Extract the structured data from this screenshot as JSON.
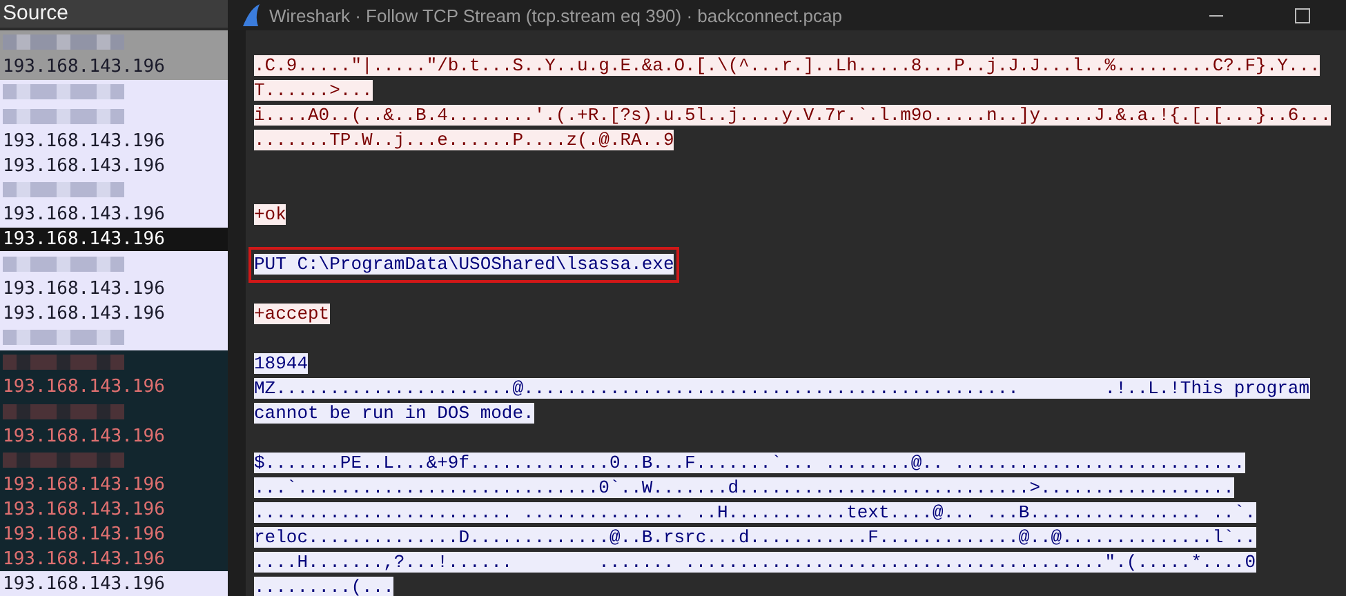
{
  "packet_list": {
    "column_header": "Source",
    "groups": [
      {
        "kind": "marked",
        "rows": [
          {
            "kind": "redacted",
            "selected": false
          },
          {
            "kind": "address",
            "text": "193.168.143.196",
            "selected": false
          }
        ]
      },
      {
        "kind": "plain",
        "rows": [
          {
            "kind": "redacted",
            "selected": false
          },
          {
            "kind": "redacted",
            "selected": false
          },
          {
            "kind": "address",
            "text": "193.168.143.196",
            "selected": false
          },
          {
            "kind": "address",
            "text": "193.168.143.196",
            "selected": false
          },
          {
            "kind": "redacted",
            "selected": false
          },
          {
            "kind": "address",
            "text": "193.168.143.196",
            "selected": false
          },
          {
            "kind": "address",
            "text": "193.168.143.196",
            "selected": true
          },
          {
            "kind": "redacted",
            "selected": false
          },
          {
            "kind": "address",
            "text": "193.168.143.196",
            "selected": false
          },
          {
            "kind": "address",
            "text": "193.168.143.196",
            "selected": false
          },
          {
            "kind": "redacted",
            "selected": false
          }
        ]
      },
      {
        "kind": "alert",
        "rows": [
          {
            "kind": "redacted",
            "selected": false
          },
          {
            "kind": "address",
            "text": "193.168.143.196",
            "selected": false
          },
          {
            "kind": "redacted",
            "selected": false
          },
          {
            "kind": "address",
            "text": "193.168.143.196",
            "selected": false
          },
          {
            "kind": "redacted",
            "selected": false
          },
          {
            "kind": "address",
            "text": "193.168.143.196",
            "selected": false
          },
          {
            "kind": "address",
            "text": "193.168.143.196",
            "selected": false
          },
          {
            "kind": "address",
            "text": "193.168.143.196",
            "selected": false
          },
          {
            "kind": "address",
            "text": "193.168.143.196",
            "selected": false
          }
        ]
      },
      {
        "kind": "plain",
        "rows": [
          {
            "kind": "address",
            "text": "193.168.143.196",
            "selected": false
          }
        ]
      }
    ]
  },
  "window": {
    "title": "Wireshark · Follow TCP Stream (tcp.stream eq 390) · backconnect.pcap"
  },
  "stream": [
    {
      "kind": "client",
      "highlighted": false,
      "lines": [
        ".C.9.....\"|.....\"/b.t...S..Y..u.g.E.&a.O.[.\\(^...r.]..Lh.....8...P..j.J.J...l..%.........C?.F}.Y...",
        "T......>...",
        "i....A0..(..&..B.4........'.(.+R.[?s).u.5l..j....y.V.7r.`.l.m9o.....n..]y.....J.&.a.!{.[.[...}..6...",
        ".......TP.W..j...e......P....z(.@.RA..9"
      ]
    },
    {
      "kind": "client",
      "highlighted": false,
      "lines": [
        "+ok"
      ]
    },
    {
      "kind": "server",
      "highlighted": true,
      "lines": [
        "PUT C:\\ProgramData\\USOShared\\lsassa.exe"
      ]
    },
    {
      "kind": "client",
      "highlighted": false,
      "lines": [
        "+accept"
      ]
    },
    {
      "kind": "server",
      "highlighted": false,
      "lines": [
        "18944",
        "MZ......................@..............................................        .!..L.!This program",
        "cannot be run in DOS mode."
      ]
    },
    {
      "kind": "server",
      "highlighted": false,
      "lines": [
        "$.......PE..L...&+9f.............0..B...F.......`... ........@.. ...........................",
        "...`............................0`..W.......d...........................>..................",
        "........................ ............... ..H...........text....@... ...B................ ..`.",
        "reloc..............D.............@..B.rsrc...d...........F.............@..@..............l`..",
        "....H.......,?...!......        ....... .......................................\".(.....*....0",
        ".........(..."
      ]
    }
  ]
}
